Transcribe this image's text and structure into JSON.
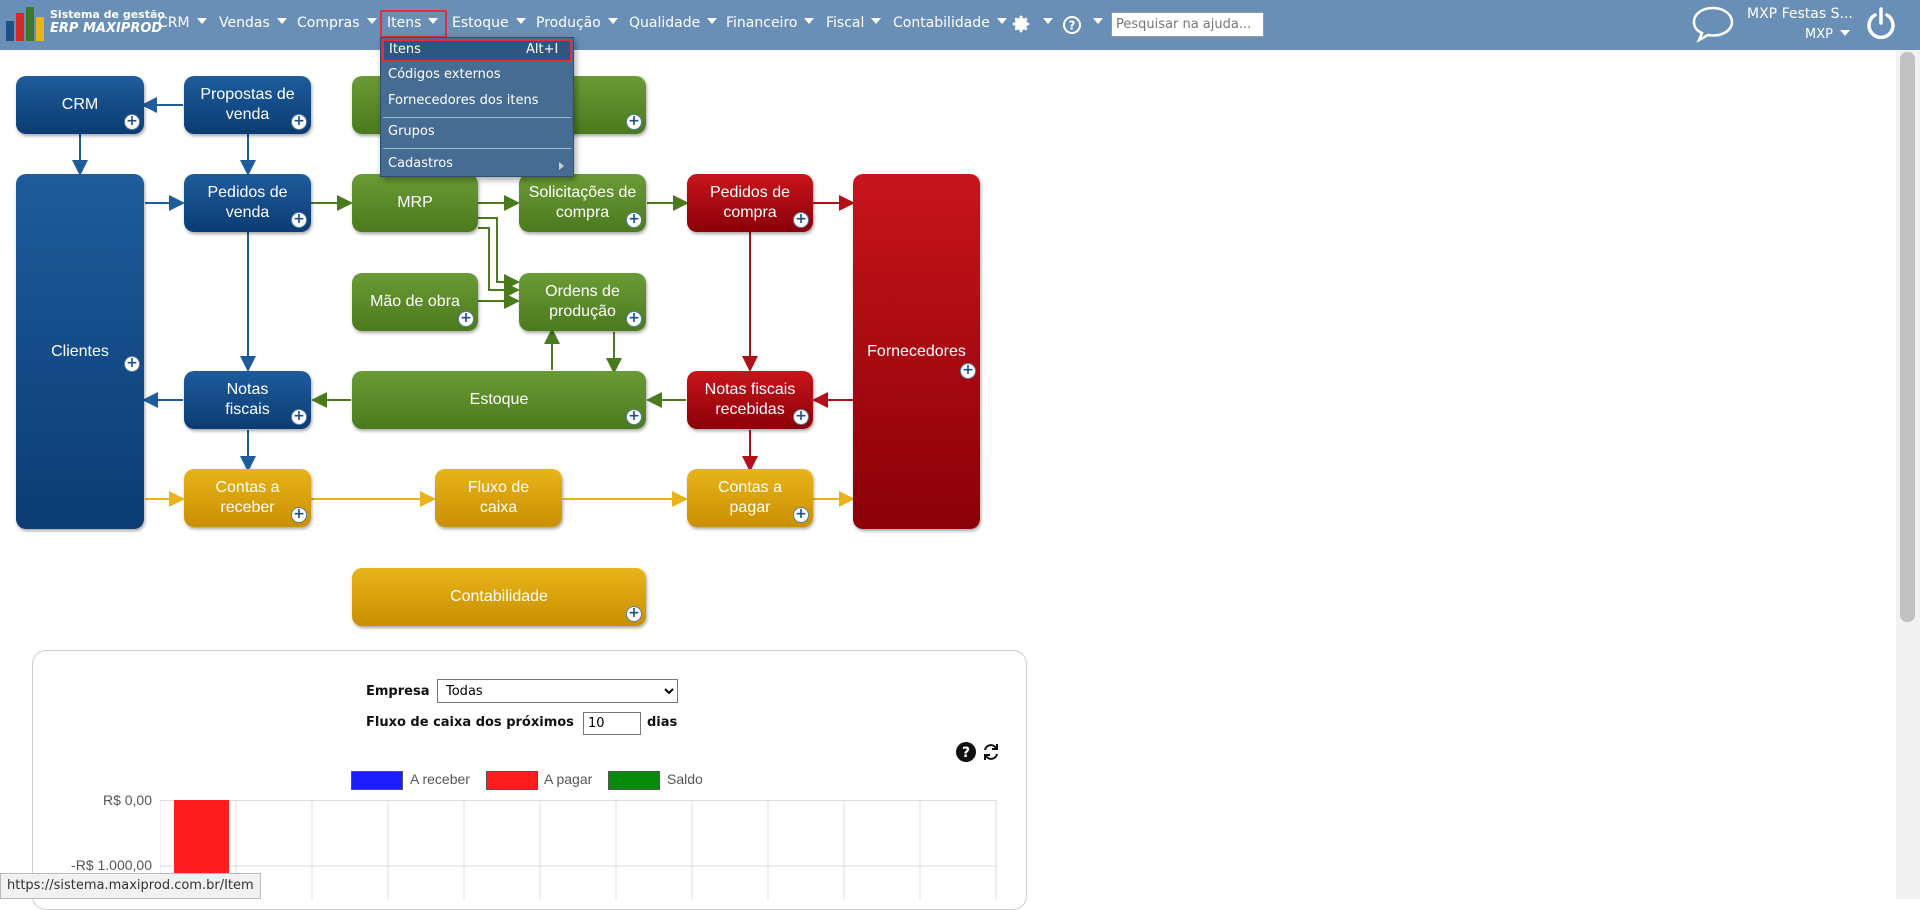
{
  "header": {
    "logo_line1": "Sistema de gestão",
    "logo_line2": "ERP MAXIPROD",
    "menu": [
      {
        "label": "CRM"
      },
      {
        "label": "Vendas"
      },
      {
        "label": "Compras"
      },
      {
        "label": "Itens"
      },
      {
        "label": "Estoque"
      },
      {
        "label": "Produção"
      },
      {
        "label": "Qualidade"
      },
      {
        "label": "Financeiro"
      },
      {
        "label": "Fiscal"
      },
      {
        "label": "Contabilidade"
      }
    ],
    "search_placeholder": "Pesquisar na ajuda...",
    "user_name": "MXP Festas S...",
    "company": "MXP"
  },
  "dropdown": {
    "items": [
      {
        "label": "Itens",
        "shortcut": "Alt+I"
      },
      {
        "label": "Códigos externos"
      },
      {
        "label": "Fornecedores dos itens"
      },
      {
        "label": "Grupos"
      },
      {
        "label": "Cadastros"
      }
    ]
  },
  "flow": {
    "crm": "CRM",
    "propostas": "Propostas de venda",
    "pedidos_venda": "Pedidos de venda",
    "clientes": "Clientes",
    "notas_fiscais": "Notas fiscais",
    "mrp": "MRP",
    "solicitacoes": "Solicitações de compra",
    "pedidos_compra": "Pedidos de compra",
    "mao_obra": "Mão de obra",
    "ordens": "Ordens de produção",
    "estoque": "Estoque",
    "notas_recebidas": "Notas fiscais recebidas",
    "fornecedores": "Fornecedores",
    "contas_receber": "Contas a receber",
    "fluxo_caixa": "Fluxo de caixa",
    "contas_pagar": "Contas a pagar",
    "contabilidade": "Contabilidade"
  },
  "cashflow": {
    "empresa_label": "Empresa",
    "empresa_value": "Todas",
    "fluxo_label": "Fluxo de caixa dos próximos",
    "dias_value": "10",
    "dias_label": "dias",
    "legend": [
      {
        "label": "A receber",
        "color": "#1c1cff"
      },
      {
        "label": "A pagar",
        "color": "#ff1c1c"
      },
      {
        "label": "Saldo",
        "color": "#0a8a0a"
      }
    ]
  },
  "chart_data": {
    "type": "bar",
    "y_ticks": [
      "R$ 0,00",
      "-R$ 1.000,00"
    ],
    "series": [
      {
        "name": "A receber",
        "values": []
      },
      {
        "name": "A pagar",
        "values": []
      },
      {
        "name": "Saldo",
        "values": []
      }
    ]
  },
  "status_bar": {
    "url": "https://sistema.maxiprod.com.br/Item"
  }
}
